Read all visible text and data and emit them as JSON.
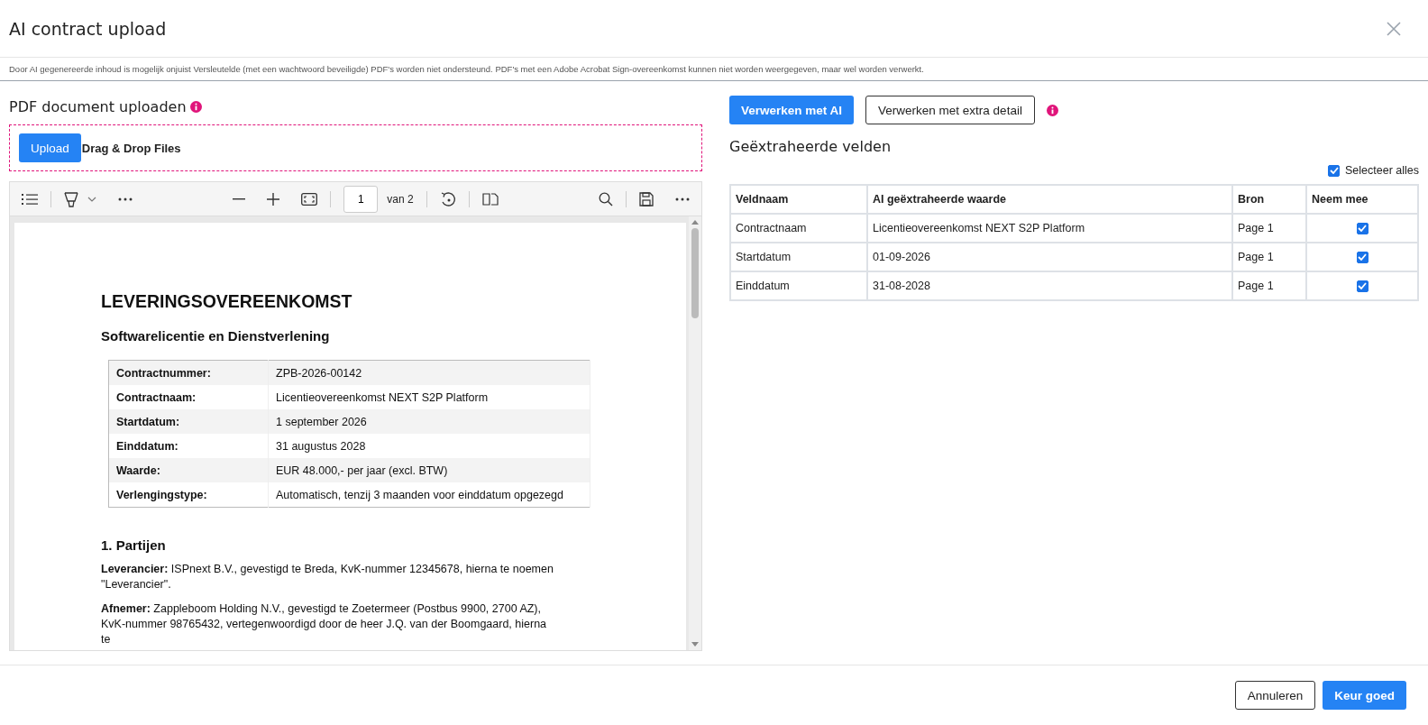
{
  "dialog": {
    "title": "AI contract upload",
    "notice": "Door AI gegenereerde inhoud is mogelijk onjuist Versleutelde (met een wachtwoord beveiligde) PDF's worden niet ondersteund. PDF's met een Adobe Acrobat Sign-overeenkomst kunnen niet worden weergegeven, maar wel worden verwerkt."
  },
  "upload": {
    "heading": "PDF document uploaden",
    "button": "Upload",
    "drop_label": "Drag & Drop Files"
  },
  "viewer": {
    "page_number": "1",
    "page_total": "van 2",
    "document": {
      "title": "LEVERINGSOVEREENKOMST",
      "subtitle": "Softwarelicentie en Dienstverlening",
      "table": [
        [
          "Contractnummer:",
          "ZPB-2026-00142"
        ],
        [
          "Contractnaam:",
          "Licentieovereenkomst NEXT S2P Platform"
        ],
        [
          "Startdatum:",
          "1 september 2026"
        ],
        [
          "Einddatum:",
          "31 augustus 2028"
        ],
        [
          "Waarde:",
          "EUR 48.000,- per jaar (excl. BTW)"
        ],
        [
          "Verlengingstype:",
          "Automatisch, tenzij 3 maanden voor einddatum opgezegd"
        ]
      ],
      "section": "1. Partijen",
      "paragraphs": [
        "**Leverancier:** ISPnext B.V., gevestigd te Breda, KvK-nummer 12345678, hierna te noemen \"Leverancier\".",
        "**Afnemer:** Zappleboom Holding N.V., gevestigd te Zoetermeer (Postbus 9900, 2700 AZ), KvK-nummer 98765432, vertegenwoordigd door de heer J.Q. van der Boomgaard, hierna te"
      ]
    }
  },
  "actions": {
    "primary": "Verwerken met AI",
    "secondary": "Verwerken met extra detail"
  },
  "extracted": {
    "heading": "Geëxtraheerde velden",
    "select_all": {
      "label": "Selecteer alles",
      "checked": true
    },
    "columns": [
      "Veldnaam",
      "AI geëxtraheerde waarde",
      "Bron",
      "Neem mee"
    ],
    "rows": [
      {
        "field": "Contractnaam",
        "value": "Licentieovereenkomst NEXT S2P Platform",
        "source": "Page 1",
        "checked": true
      },
      {
        "field": "Startdatum",
        "value": "01-09-2026",
        "source": "Page 1",
        "checked": true
      },
      {
        "field": "Einddatum",
        "value": "31-08-2028",
        "source": "Page 1",
        "checked": true
      }
    ]
  },
  "footer": {
    "cancel": "Annuleren",
    "approve": "Keur goed"
  }
}
